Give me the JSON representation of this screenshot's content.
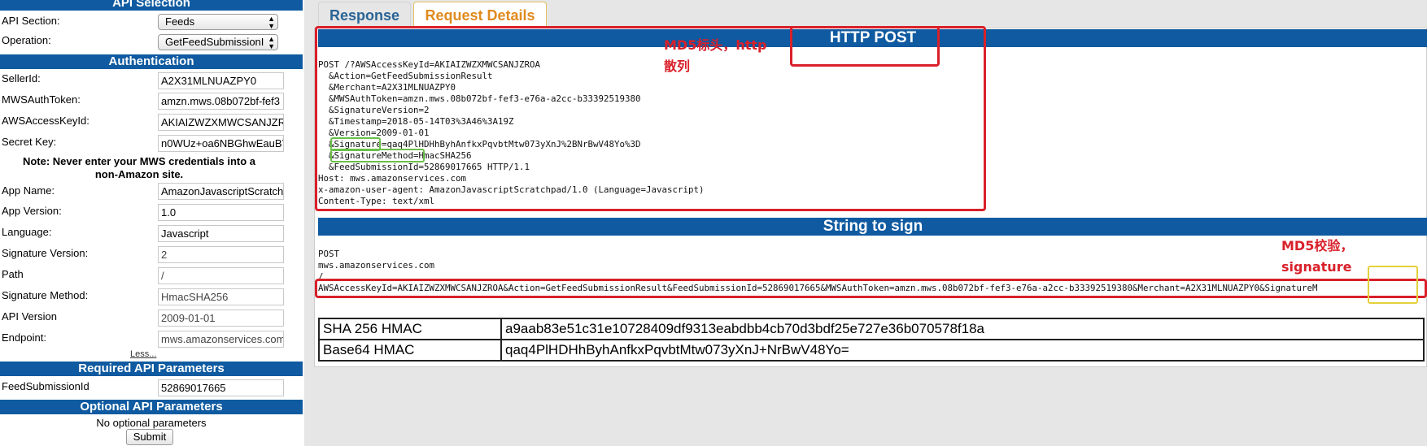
{
  "left_panel": {
    "api_selection": {
      "header": "API Selection",
      "api_section_label": "API Section:",
      "api_section_value": "Feeds",
      "operation_label": "Operation:",
      "operation_value": "GetFeedSubmissionI"
    },
    "authentication": {
      "header": "Authentication",
      "fields": [
        {
          "label": "SellerId:",
          "value": "A2X31MLNUAZPY0"
        },
        {
          "label": "MWSAuthToken:",
          "value": "amzn.mws.08b072bf-fef3"
        },
        {
          "label": "AWSAccessKeyId:",
          "value": "AKIAIZWZXMWCSANJZROA"
        },
        {
          "label": "Secret Key:",
          "value": "n0WUz+oa6NBGhwEauBYl"
        }
      ],
      "note": "Note: Never enter your MWS credentials into a non-Amazon site.",
      "more_fields": [
        {
          "label": "App Name:",
          "value": "AmazonJavascriptScratch"
        },
        {
          "label": "App Version:",
          "value": "1.0"
        },
        {
          "label": "Language:",
          "value": "Javascript"
        },
        {
          "label": "Signature Version:",
          "value": "2"
        },
        {
          "label": "Path",
          "value": "/"
        },
        {
          "label": "Signature Method:",
          "value": "HmacSHA256"
        },
        {
          "label": "API Version",
          "value": "2009-01-01"
        },
        {
          "label": "Endpoint:",
          "value": "mws.amazonservices.com"
        }
      ],
      "less_link": "Less..."
    },
    "required": {
      "header": "Required API Parameters",
      "label": "FeedSubmissionId",
      "value": "52869017665"
    },
    "optional": {
      "header": "Optional API Parameters",
      "text": "No optional parameters"
    },
    "submit_label": "Submit"
  },
  "tabs": {
    "response": "Response",
    "request_details": "Request Details"
  },
  "http_post": {
    "header": "HTTP POST",
    "lines": [
      "POST /?AWSAccessKeyId=AKIAIZWZXMWCSANJZROA",
      "  &Action=GetFeedSubmissionResult",
      "  &Merchant=A2X31MLNUAZPY0",
      "  &MWSAuthToken=amzn.mws.08b072bf-fef3-e76a-a2cc-b33392519380",
      "  &SignatureVersion=2",
      "  &Timestamp=2018-05-14T03%3A46%3A19Z",
      "  &Version=2009-01-01",
      "  &Signature=qaq4PlHDHhByhAnfkxPqvbtMtw073yXnJ%2BNrBwV48Yo%3D",
      "  &SignatureMethod=HmacSHA256",
      "  &FeedSubmissionId=52869017665 HTTP/1.1",
      "Host: mws.amazonservices.com",
      "x-amazon-user-agent: AmazonJavascriptScratchpad/1.0 (Language=Javascript)",
      "Content-Type: text/xml"
    ]
  },
  "string_to_sign": {
    "header": "String to sign",
    "lines": [
      "POST",
      "mws.amazonservices.com",
      "/",
      "AWSAccessKeyId=AKIAIZWZXMWCSANJZROA&Action=GetFeedSubmissionResult&FeedSubmissionId=52869017665&MWSAuthToken=amzn.mws.08b072bf-fef3-e76a-a2cc-b33392519380&Merchant=A2X31MLNUAZPY0&SignatureM"
    ]
  },
  "hmac": {
    "sha256_label": "SHA 256 HMAC",
    "sha256_value": "a9aab83e51c31e10728409df9313eabdbb4cb70d3bdf25e727e36b070578f18a",
    "base64_label": "Base64 HMAC",
    "base64_value": "qaq4PlHDHhByhAnfkxPqvbtMtw073yXnJ+NrBwV48Yo="
  },
  "annotations": {
    "md5_header_line1": "MD5标头，http",
    "md5_header_line2": "散列",
    "md5_check_line1": "MD5校验，",
    "md5_check_line2": "signature"
  },
  "colors": {
    "header_blue": "#0f5aa0",
    "annotation_red": "#d9202a",
    "highlight_green": "#6bbf4a",
    "highlight_yellow": "#e4d03c",
    "tab_active_orange": "#e08a1e"
  }
}
